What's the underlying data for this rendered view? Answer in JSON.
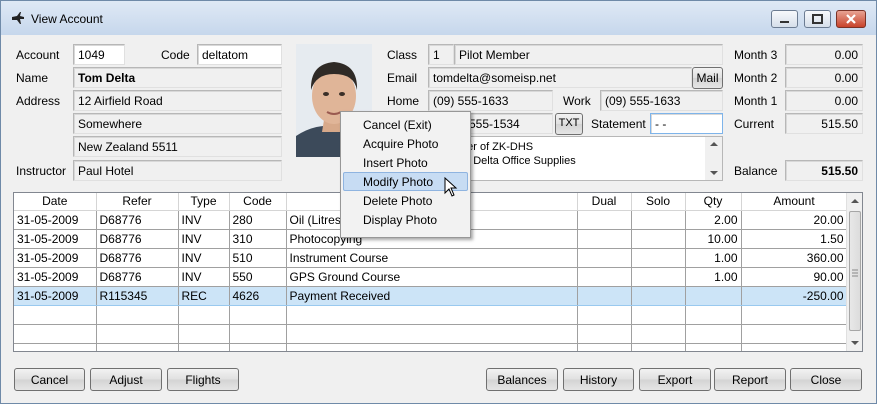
{
  "window": {
    "title": "View Account"
  },
  "account": {
    "account_label": "Account",
    "account_value": "1049",
    "code_label": "Code",
    "code_value": "deltatom",
    "name_label": "Name",
    "name_value": "Tom Delta",
    "address_label": "Address",
    "address_lines": [
      "12 Airfield Road",
      "Somewhere",
      "New Zealand 5511"
    ],
    "instructor_label": "Instructor",
    "instructor_value": "Paul Hotel"
  },
  "contact": {
    "class_label": "Class",
    "class_num": "1",
    "class_value": "Pilot Member",
    "email_label": "Email",
    "email_value": "tomdelta@someisp.net",
    "mail_button": "Mail",
    "home_label": "Home",
    "home_value": "(09) 555-1633",
    "work_label": "Work",
    "work_value": "(09) 555-1633",
    "fax_value": "555-1534",
    "txt_button": "TXT",
    "statement_label": "Statement",
    "statement_value": "-  -",
    "notes": [
      "ner of ZK-DHS",
      "of Delta Office Supplies"
    ]
  },
  "balances": {
    "month3_label": "Month 3",
    "month3_value": "0.00",
    "month2_label": "Month 2",
    "month2_value": "0.00",
    "month1_label": "Month 1",
    "month1_value": "0.00",
    "current_label": "Current",
    "current_value": "515.50",
    "balance_label": "Balance",
    "balance_value": "515.50"
  },
  "context_menu": {
    "items": [
      "Cancel (Exit)",
      "Acquire Photo",
      "Insert Photo",
      "Modify Photo",
      "Delete Photo",
      "Display Photo"
    ],
    "highlighted": "Modify Photo"
  },
  "table": {
    "headers": [
      "Date",
      "Refer",
      "Type",
      "Code",
      "",
      "Dual",
      "Solo",
      "Qty",
      "Amount"
    ],
    "rows": [
      [
        "31-05-2009",
        "D68776",
        "INV",
        "280",
        "Oil (Litres",
        "",
        "",
        "2.00",
        "20.00"
      ],
      [
        "31-05-2009",
        "D68776",
        "INV",
        "310",
        "Photocopying",
        "",
        "",
        "10.00",
        "1.50"
      ],
      [
        "31-05-2009",
        "D68776",
        "INV",
        "510",
        "Instrument Course",
        "",
        "",
        "1.00",
        "360.00"
      ],
      [
        "31-05-2009",
        "D68776",
        "INV",
        "550",
        "GPS Ground Course",
        "",
        "",
        "1.00",
        "90.00"
      ],
      [
        "31-05-2009",
        "R115345",
        "REC",
        "4626",
        "Payment Received",
        "",
        "",
        "",
        "-250.00"
      ]
    ]
  },
  "buttons": {
    "cancel": "Cancel",
    "adjust": "Adjust",
    "flights": "Flights",
    "balances": "Balances",
    "history": "History",
    "export": "Export",
    "report": "Report",
    "close": "Close"
  },
  "colors": {
    "selection": "#cce4f7",
    "menu_highlight": "#c7dcf3",
    "title_bar": "#c6d7ec"
  }
}
